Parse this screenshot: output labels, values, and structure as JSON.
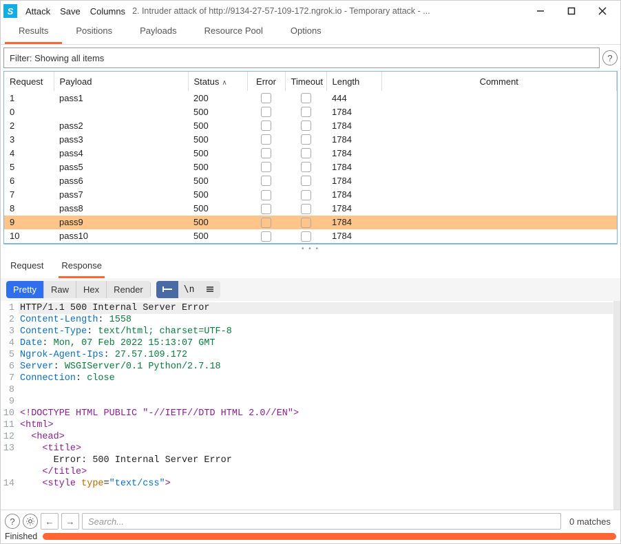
{
  "titlebar": {
    "menu": {
      "attack": "Attack",
      "save": "Save",
      "columns": "Columns"
    },
    "title": "2. Intruder attack of http://9134-27-57-109-172.ngrok.io - Temporary attack - ..."
  },
  "main_tabs": {
    "results": "Results",
    "positions": "Positions",
    "payloads": "Payloads",
    "resource_pool": "Resource Pool",
    "options": "Options"
  },
  "filter": {
    "text": "Filter: Showing all items"
  },
  "columns": {
    "request": "Request",
    "payload": "Payload",
    "status": "Status",
    "error": "Error",
    "timeout": "Timeout",
    "length": "Length",
    "comment": "Comment"
  },
  "rows": [
    {
      "req": "1",
      "pay": "pass1",
      "stat": "200",
      "len": "444",
      "sel": false
    },
    {
      "req": "0",
      "pay": "",
      "stat": "500",
      "len": "1784",
      "sel": false
    },
    {
      "req": "2",
      "pay": "pass2",
      "stat": "500",
      "len": "1784",
      "sel": false
    },
    {
      "req": "3",
      "pay": "pass3",
      "stat": "500",
      "len": "1784",
      "sel": false
    },
    {
      "req": "4",
      "pay": "pass4",
      "stat": "500",
      "len": "1784",
      "sel": false
    },
    {
      "req": "5",
      "pay": "pass5",
      "stat": "500",
      "len": "1784",
      "sel": false
    },
    {
      "req": "6",
      "pay": "pass6",
      "stat": "500",
      "len": "1784",
      "sel": false
    },
    {
      "req": "7",
      "pay": "pass7",
      "stat": "500",
      "len": "1784",
      "sel": false
    },
    {
      "req": "8",
      "pay": "pass8",
      "stat": "500",
      "len": "1784",
      "sel": false
    },
    {
      "req": "9",
      "pay": "pass9",
      "stat": "500",
      "len": "1784",
      "sel": true
    },
    {
      "req": "10",
      "pay": "pass10",
      "stat": "500",
      "len": "1784",
      "sel": false
    }
  ],
  "subtabs": {
    "request": "Request",
    "response": "Response"
  },
  "viewer": {
    "pretty": "Pretty",
    "raw": "Raw",
    "hex": "Hex",
    "render": "Render"
  },
  "response_lines": {
    "l1": "HTTP/1.1 500 Internal Server Error",
    "l2a": "Content-Length",
    "l2b": ": ",
    "l2c": "1558",
    "l3a": "Content-Type",
    "l3b": ": ",
    "l3c": "text/html; charset=UTF-8",
    "l4a": "Date",
    "l4b": ": ",
    "l4c": "Mon, 07 Feb 2022 15:13:07 GMT",
    "l5a": "Ngrok-Agent-Ips",
    "l5b": ": ",
    "l5c": "27.57.109.172",
    "l6a": "Server",
    "l6b": ": ",
    "l6c": "WSGIServer/0.1 Python/2.7.18",
    "l7a": "Connection",
    "l7b": ": ",
    "l7c": "close",
    "l10": "<!DOCTYPE HTML PUBLIC \"-//IETF//DTD HTML 2.0//EN\">",
    "l11a": "<",
    "l11b": "html",
    "l11c": ">",
    "l12a": "  <",
    "l12b": "head",
    "l12c": ">",
    "l13a": "    <",
    "l13b": "title",
    "l13c": ">",
    "l13t": "      Error: 500 Internal Server Error",
    "l13d": "    </",
    "l13e": "title",
    "l13f": ">",
    "l14a": "    <",
    "l14b": "style ",
    "l14c": "type",
    "l14d": "=",
    "l14e": "\"text/css\"",
    "l14f": ">"
  },
  "search": {
    "placeholder": "Search...",
    "matches": "0 matches"
  },
  "status": {
    "text": "Finished"
  }
}
